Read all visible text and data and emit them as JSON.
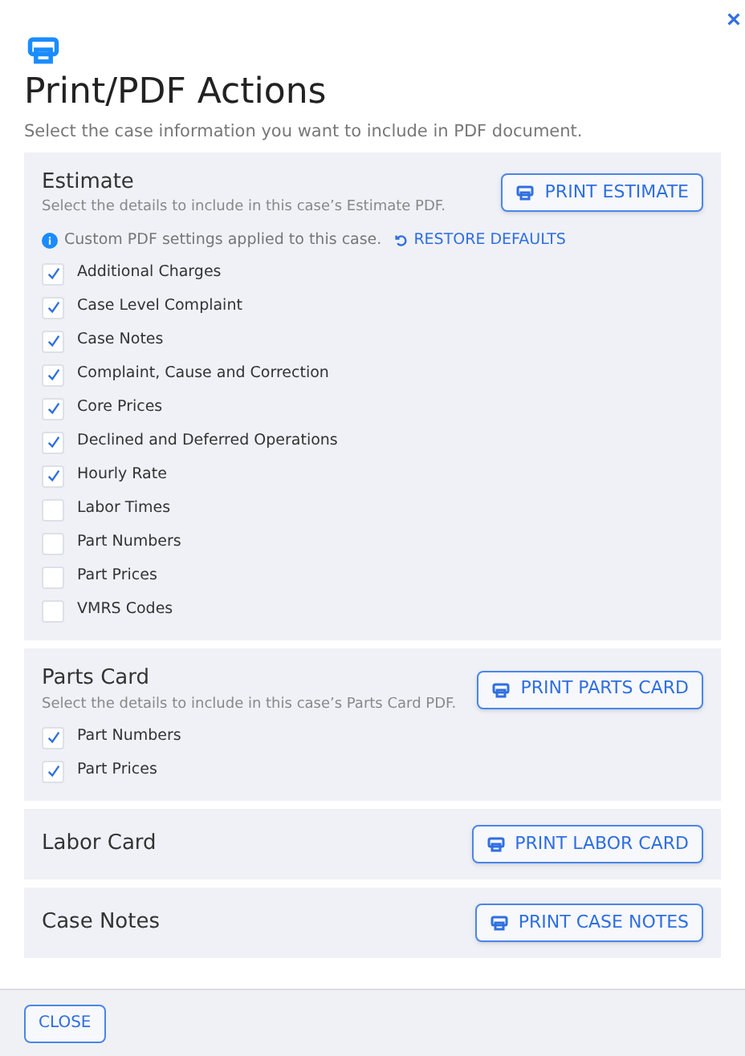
{
  "dialog": {
    "title": "Print/PDF Actions",
    "subtitle": "Select the case information you want to include in PDF document."
  },
  "sections": [
    {
      "title": "Estimate",
      "description": "Select the details to include in this case’s Estimate PDF.",
      "button": "PRINT ESTIMATE",
      "notice": {
        "text": "Custom PDF settings applied to this case.",
        "link": "RESTORE DEFAULTS"
      },
      "options": [
        {
          "label": "Additional Charges",
          "checked": true
        },
        {
          "label": "Case Level Complaint",
          "checked": true
        },
        {
          "label": "Case Notes",
          "checked": true
        },
        {
          "label": "Complaint, Cause and Correction",
          "checked": true
        },
        {
          "label": "Core Prices",
          "checked": true
        },
        {
          "label": "Declined and Deferred Operations",
          "checked": true
        },
        {
          "label": "Hourly Rate",
          "checked": true
        },
        {
          "label": "Labor Times",
          "checked": false
        },
        {
          "label": "Part Numbers",
          "checked": false
        },
        {
          "label": "Part Prices",
          "checked": false
        },
        {
          "label": "VMRS Codes",
          "checked": false
        }
      ]
    },
    {
      "title": "Parts Card",
      "description": "Select the details to include in this case’s Parts Card PDF.",
      "button": "PRINT PARTS CARD",
      "options": [
        {
          "label": "Part Numbers",
          "checked": true
        },
        {
          "label": "Part Prices",
          "checked": true
        }
      ]
    },
    {
      "title": "Labor Card",
      "button": "PRINT LABOR CARD"
    },
    {
      "title": "Case Notes",
      "button": "PRINT CASE NOTES"
    }
  ],
  "footer": {
    "button": "CLOSE"
  }
}
